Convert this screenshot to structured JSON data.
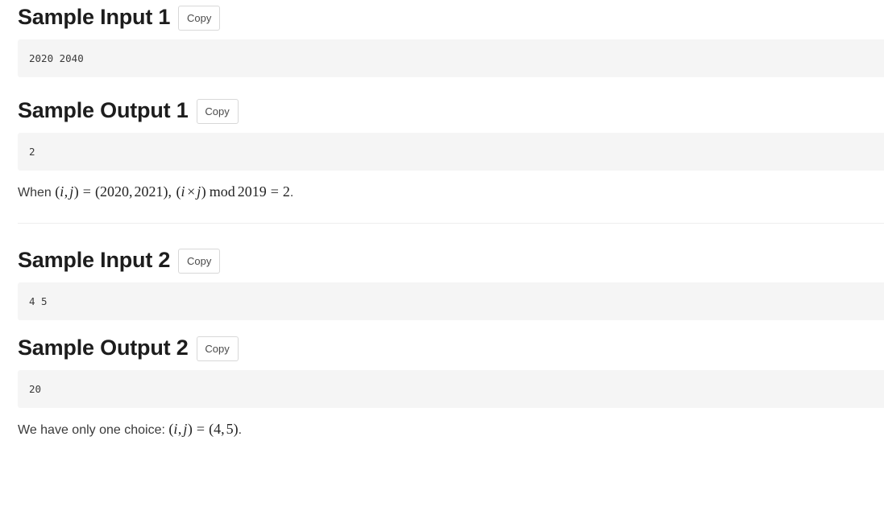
{
  "sections": [
    {
      "title": "Sample Input 1",
      "copy_label": "Copy",
      "content": "2020 2040",
      "kind": "input"
    },
    {
      "title": "Sample Output 1",
      "copy_label": "Copy",
      "content": "2",
      "kind": "output",
      "note": {
        "lead": "When ",
        "math": [
          {
            "t": "mopen",
            "v": "("
          },
          {
            "t": "mi",
            "v": "i"
          },
          {
            "t": "mpunct",
            "v": ","
          },
          {
            "t": "mi",
            "v": "j"
          },
          {
            "t": "mclose",
            "v": ")"
          },
          {
            "t": "mrel",
            "v": "="
          },
          {
            "t": "mopen",
            "v": "("
          },
          {
            "t": "mn",
            "v": "2020"
          },
          {
            "t": "mpunct",
            "v": ","
          },
          {
            "t": "mn",
            "v": "2021"
          },
          {
            "t": "mclose",
            "v": ")"
          },
          {
            "t": "mpunct",
            "v": ","
          },
          {
            "t": "sp",
            "v": " "
          },
          {
            "t": "mopen",
            "v": "("
          },
          {
            "t": "mi",
            "v": "i"
          },
          {
            "t": "mo",
            "v": "×"
          },
          {
            "t": "mi",
            "v": "j"
          },
          {
            "t": "mclose",
            "v": ")"
          },
          {
            "t": "mop",
            "v": "mod"
          },
          {
            "t": "mn",
            "v": "2019"
          },
          {
            "t": "mrel",
            "v": "="
          },
          {
            "t": "mn",
            "v": "2"
          }
        ],
        "tail": "."
      }
    },
    {
      "title": "Sample Input 2",
      "copy_label": "Copy",
      "content": "4 5",
      "kind": "input"
    },
    {
      "title": "Sample Output 2",
      "copy_label": "Copy",
      "content": "20",
      "kind": "output",
      "note": {
        "lead": "We have only one choice: ",
        "math": [
          {
            "t": "mopen",
            "v": "("
          },
          {
            "t": "mi",
            "v": "i"
          },
          {
            "t": "mpunct",
            "v": ","
          },
          {
            "t": "mi",
            "v": "j"
          },
          {
            "t": "mclose",
            "v": ")"
          },
          {
            "t": "mrel",
            "v": "="
          },
          {
            "t": "mopen",
            "v": "("
          },
          {
            "t": "mn",
            "v": "4"
          },
          {
            "t": "mpunct",
            "v": ","
          },
          {
            "t": "mn",
            "v": "5"
          },
          {
            "t": "mclose",
            "v": ")"
          }
        ],
        "tail": "."
      }
    }
  ],
  "colors": {
    "pre_background": "#f5f5f5",
    "heading_text": "#1d1d1d",
    "body_text": "#3a3a3a",
    "button_border": "#d8d8d8",
    "divider": "#eeeeee"
  }
}
